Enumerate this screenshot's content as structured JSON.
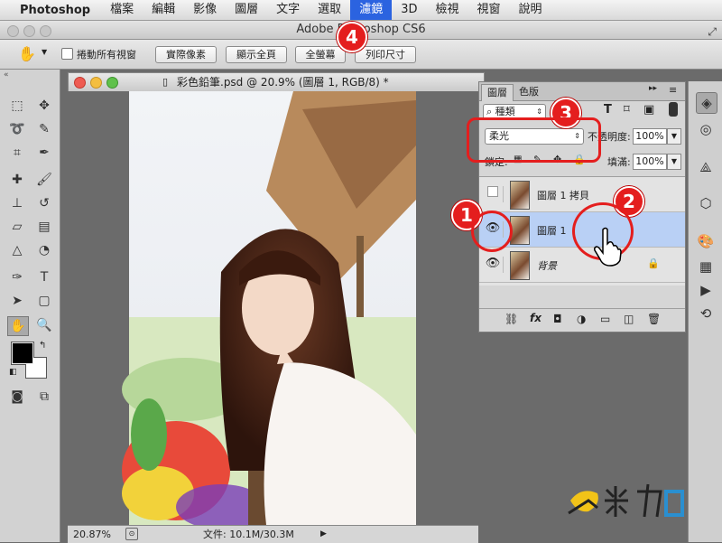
{
  "menubar": {
    "apple": "",
    "app_name": "Photoshop",
    "items": [
      "檔案",
      "編輯",
      "影像",
      "圖層",
      "文字",
      "選取",
      "濾鏡",
      "3D",
      "檢視",
      "視窗",
      "說明"
    ]
  },
  "window": {
    "title": "Adobe Photoshop CS6"
  },
  "options_bar": {
    "scroll_all_label": "捲動所有視窗",
    "buttons": [
      "實際像素",
      "顯示全頁",
      "全螢幕",
      "列印尺寸"
    ]
  },
  "document": {
    "title": "彩色鉛筆.psd @ 20.9% (圖層 1, RGB/8) *",
    "zoom": "20.87%",
    "file_info": "文件: 10.1M/30.3M"
  },
  "layers_panel": {
    "tabs": [
      "圖層",
      "色版"
    ],
    "filter_kind": "種類",
    "blend_mode": "柔光",
    "opacity_label": "不透明度:",
    "opacity_value": "100%",
    "lock_label": "鎖定:",
    "fill_label": "填滿:",
    "fill_value": "100%",
    "layers": [
      {
        "name": "圖層 1 拷貝",
        "visible": false,
        "selected": false,
        "locked": false
      },
      {
        "name": "圖層 1",
        "visible": true,
        "selected": true,
        "locked": false
      },
      {
        "name": "背景",
        "visible": true,
        "selected": false,
        "locked": true
      }
    ],
    "fx_label": "fx"
  },
  "annotations": [
    "1",
    "2",
    "3",
    "4"
  ],
  "watermark": {
    "text": "奧米加"
  },
  "colors": {
    "selected_layer": "#b9d0f5",
    "menu_active": "#2b63e0",
    "annotation_red": "#e41e1e"
  }
}
